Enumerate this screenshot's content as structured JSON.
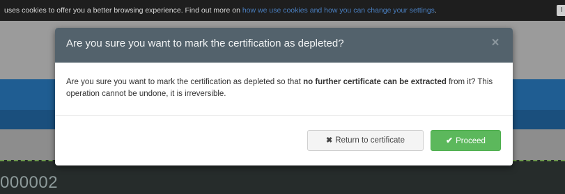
{
  "cookie_bar": {
    "text": "uses cookies to offer you a better browsing experience. Find out more on",
    "link_text": "how we use cookies and how you can change your settings",
    "accept_label": "I a"
  },
  "background": {
    "number_text": "000002"
  },
  "modal": {
    "title": "Are you sure you want to mark the certification as depleted?",
    "close_icon": "×",
    "body": {
      "text_before": "Are you sure you want to mark the certification as depleted so that ",
      "text_bold": "no further certificate can be extracted",
      "text_after": " from it? This operation cannot be undone, it is irreversible."
    },
    "buttons": {
      "return_icon": "✖",
      "return_label": "Return to certificate",
      "proceed_icon": "✔",
      "proceed_label": "Proceed"
    }
  },
  "colors": {
    "header_bg": "#53626c",
    "proceed_bg": "#5cb85c",
    "return_bg": "#f4f4f4"
  }
}
